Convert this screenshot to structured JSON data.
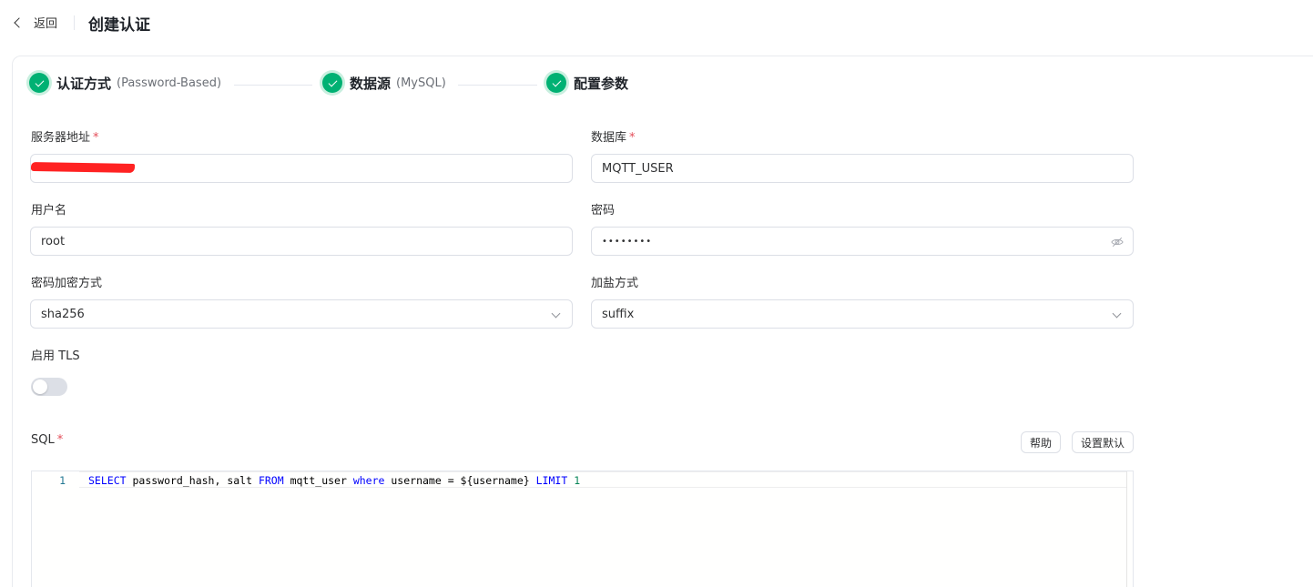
{
  "header": {
    "back_label": "返回",
    "title": "创建认证"
  },
  "steps": [
    {
      "title": "认证方式",
      "desc": "(Password-Based)",
      "status": "done"
    },
    {
      "title": "数据源",
      "desc": "(MySQL)",
      "status": "done"
    },
    {
      "title": "配置参数",
      "desc": "",
      "status": "done"
    }
  ],
  "form": {
    "server": {
      "label": "服务器地址",
      "required_mark": "*",
      "value": ""
    },
    "database": {
      "label": "数据库",
      "required_mark": "*",
      "value": "MQTT_USER"
    },
    "username": {
      "label": "用户名",
      "value": "root"
    },
    "password": {
      "label": "密码",
      "value": "••••••••"
    },
    "hash": {
      "label": "密码加密方式",
      "value": "sha256"
    },
    "salt": {
      "label": "加盐方式",
      "value": "suffix"
    },
    "tls": {
      "label": "启用 TLS",
      "enabled": false
    },
    "sql": {
      "label": "SQL",
      "required_mark": "*",
      "help_button": "帮助",
      "default_button": "设置默认",
      "line_number": "1",
      "tokens": {
        "t1": "SELECT",
        "t2": " password_hash, salt ",
        "t3": "FROM",
        "t4": " mqtt_user ",
        "t5": "where",
        "t6": " username = ${username} ",
        "t7": "LIMIT",
        "t8": " ",
        "t9": "1"
      }
    }
  },
  "colors": {
    "accent": "#00b173",
    "required": "#e34d59",
    "sql_keyword": "#0000ff",
    "sql_number": "#098658",
    "redaction": "#ff2222"
  }
}
